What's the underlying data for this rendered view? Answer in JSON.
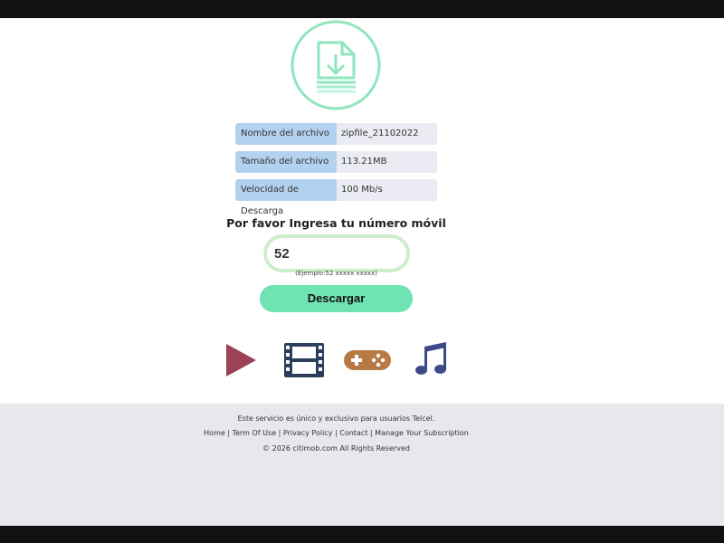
{
  "info_rows": [
    {
      "label": "Nombre del archivo",
      "value": "zipfile_21102022"
    },
    {
      "label": "Tamaño del archivo",
      "value": "113.21MB"
    },
    {
      "label": "Velocidad de Descarga",
      "value": "100 Mb/s"
    }
  ],
  "form": {
    "prompt": "Por favor Ingresa tu número móvil",
    "phone_value": "52",
    "hint": "(Ejemplo:52 xxxxx xxxxx)",
    "submit_label": "Descargar"
  },
  "footer": {
    "notice": "Este servicio es único y exclusivo para usuarios Telcel.",
    "links": [
      "Home",
      "Term Of Use",
      "Privacy Policy",
      "Contact",
      "Manage Your Subscription"
    ],
    "separator": "|",
    "copyright": "© 2026 citimob.com  All Rights Reserved"
  },
  "icons": [
    "download-file-icon",
    "play-icon",
    "film-icon",
    "gamepad-icon",
    "music-note-icon"
  ],
  "colors": {
    "accent_green": "#6fe3b2",
    "label_blue": "#b3d2ef",
    "value_gray": "#ebebf3",
    "play_red": "#9c4257",
    "film_navy": "#2d3e5c",
    "gamepad_brown": "#b87a45",
    "music_indigo": "#3d4a8a",
    "footer_bg": "#e8e8ec"
  }
}
